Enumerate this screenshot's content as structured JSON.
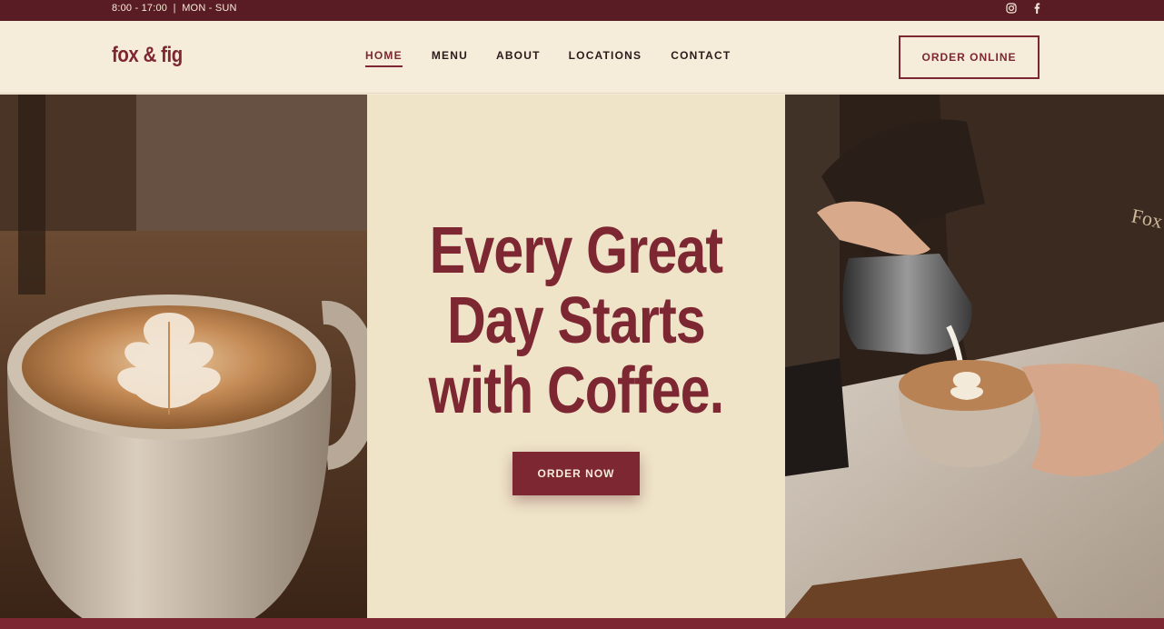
{
  "topbar": {
    "hours": "8:00 - 17:00  |  MON - SUN",
    "social_icons": [
      "instagram-icon",
      "facebook-icon"
    ]
  },
  "header": {
    "logo": "fox & fig",
    "nav": [
      {
        "label": "HOME",
        "active": true
      },
      {
        "label": "MENU",
        "active": false
      },
      {
        "label": "ABOUT",
        "active": false
      },
      {
        "label": "LOCATIONS",
        "active": false
      },
      {
        "label": "CONTACT",
        "active": false
      }
    ],
    "cta_label": "ORDER ONLINE"
  },
  "hero": {
    "headline_lines": [
      "Every Great",
      "Day Starts",
      "with Coffee."
    ],
    "button_label": "ORDER NOW",
    "left_image": "latte-art-cup-photo",
    "right_image": "barista-pouring-milk-photo",
    "apron_text": "Fox"
  },
  "colors": {
    "brand": "#7d2733",
    "topbar": "#5a1c24",
    "cream": "#f6ecda",
    "hero_panel": "#efe3c8"
  }
}
